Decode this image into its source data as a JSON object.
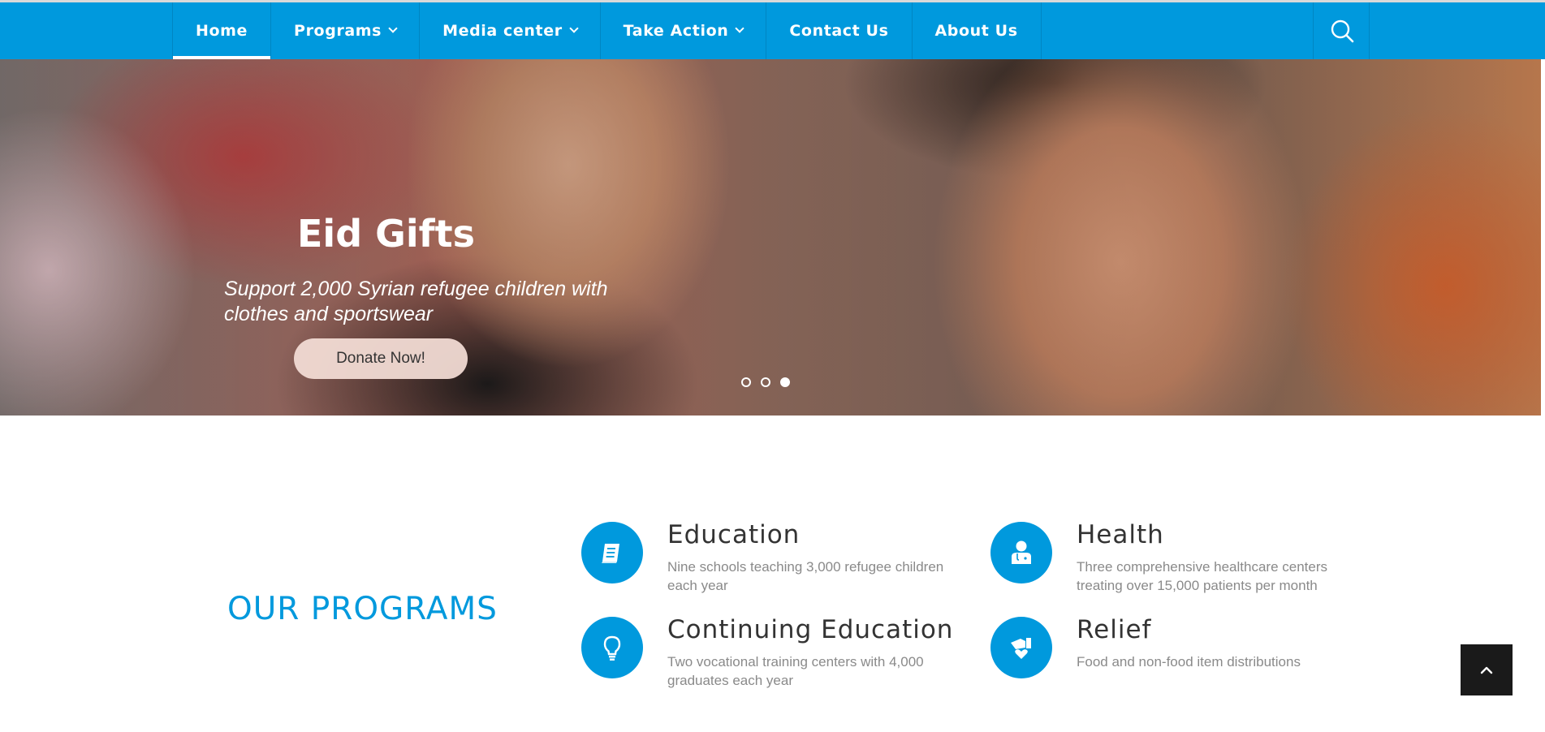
{
  "nav": {
    "items": [
      {
        "label": "Home",
        "active": true,
        "dropdown": false
      },
      {
        "label": "Programs",
        "active": false,
        "dropdown": true
      },
      {
        "label": "Media center",
        "active": false,
        "dropdown": true
      },
      {
        "label": "Take Action",
        "active": false,
        "dropdown": true
      },
      {
        "label": "Contact Us",
        "active": false,
        "dropdown": false
      },
      {
        "label": "About Us",
        "active": false,
        "dropdown": false
      }
    ],
    "search_icon": "search-icon"
  },
  "hero": {
    "title": "Eid Gifts",
    "subtitle": "Support 2,000 Syrian refugee children with clothes and sportswear",
    "cta_label": "Donate Now!",
    "slides_total": 3,
    "active_slide": 3
  },
  "programs": {
    "section_title": "OUR PROGRAMS",
    "items": [
      {
        "name": "Education",
        "description": "Nine schools teaching 3,000 refugee children each year",
        "icon": "book-icon"
      },
      {
        "name": "Health",
        "description": "Three comprehensive healthcare centers treating over 15,000 patients per month",
        "icon": "doctor-icon"
      },
      {
        "name": "Continuing Education",
        "description": "Two vocational training centers with 4,000 graduates each year",
        "icon": "lightbulb-icon"
      },
      {
        "name": "Relief",
        "description": "Food and non-food item distributions",
        "icon": "hand-heart-icon"
      }
    ]
  },
  "colors": {
    "primary": "#0099dd",
    "back_to_top_bg": "#1a1a1a"
  },
  "back_to_top_icon": "chevron-up-icon"
}
